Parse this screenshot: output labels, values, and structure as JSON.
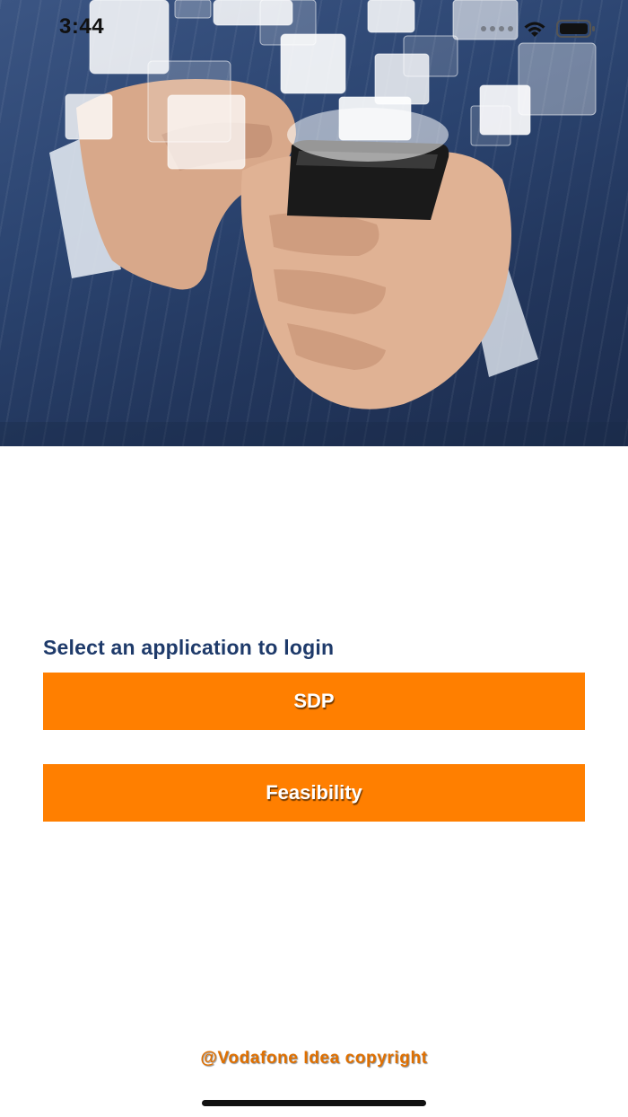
{
  "status_bar": {
    "time": "3:44"
  },
  "hero": {
    "image_icon": "hand-holding-phone-illustration"
  },
  "login": {
    "prompt": "Select an application to login",
    "buttons": [
      {
        "label": "SDP"
      },
      {
        "label": "Feasibility"
      }
    ]
  },
  "footer": {
    "copyright": "@Vodafone Idea copyright"
  },
  "colors": {
    "accent": "#ff7f00",
    "prompt_text": "#1e3a6a",
    "copyright_text": "#e07000"
  }
}
